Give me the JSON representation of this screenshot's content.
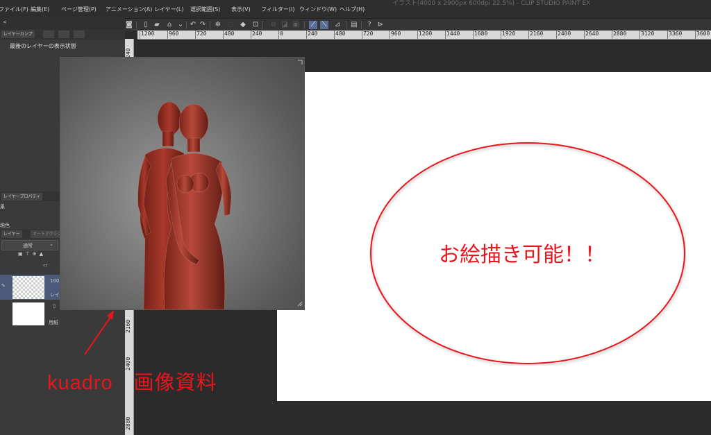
{
  "window_title": "イラスト(4000 x 2900px 600dpi 22.5%) - CLIP STUDIO PAINT EX",
  "menu": [
    "ファイル(F)",
    "編集(E)",
    "ページ管理(P)",
    "アニメーション(A)",
    "レイヤー(L)",
    "選択範囲(S)",
    "表示(V)",
    "フィルター(I)",
    "ウィンドウ(W)",
    "ヘルプ(H)"
  ],
  "left_panel": {
    "top_tab": "レイヤーカンプ",
    "title": "最後のレイヤーの表示状態",
    "props_tab": "レイヤープロパティ",
    "effect_label": "果",
    "color_label": "現色",
    "layer_tab": "レイヤー",
    "auto_tab": "オートアクション",
    "blend_mode": "通常",
    "layers": [
      {
        "opacity": "100",
        "name": "レイ"
      },
      {
        "name": "用紙"
      }
    ]
  },
  "ruler": {
    "h_labels": [
      "1200",
      "960",
      "720",
      "480",
      "240",
      "0",
      "240",
      "480",
      "720",
      "960",
      "1200",
      "1440",
      "1680",
      "1920",
      "2160",
      "2400",
      "2640",
      "2880",
      "3120",
      "3360",
      "3600"
    ],
    "v_labels": [
      "240",
      "2160",
      "2400",
      "2880"
    ]
  },
  "canvas": {
    "annotation": "お絵描き可能！！"
  },
  "annotation_label": "kuadro　画像資料",
  "colors": {
    "accent": "#e8161c",
    "ui_bg": "#2b2b2b",
    "selected_layer": "#4b5a78"
  }
}
